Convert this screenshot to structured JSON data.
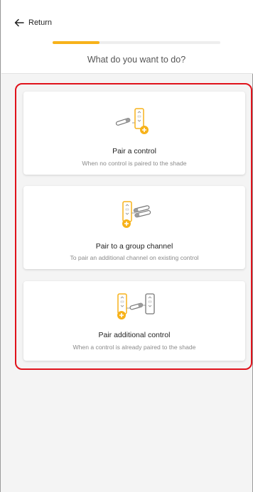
{
  "header": {
    "return_label": "Return",
    "progress_fraction": 0.28,
    "question": "What do you want to do?"
  },
  "options": [
    {
      "title": "Pair a control",
      "description": "When no control is paired to the shade",
      "icon": "remote-pair-plus-icon"
    },
    {
      "title": "Pair to a group channel",
      "description": "To pair an additional channel on existing control",
      "icon": "group-channel-pair-icon"
    },
    {
      "title": "Pair additional control",
      "description": "When a control is already paired to the shade",
      "icon": "additional-remote-pair-icon"
    }
  ],
  "colors": {
    "accent": "#f7b21a",
    "highlight_border": "#e0121b",
    "background": "#f4f4f4"
  }
}
